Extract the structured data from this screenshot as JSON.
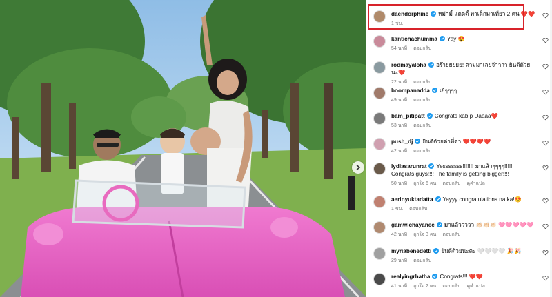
{
  "accent": "#d8232a",
  "verified_color": "#1d9bf0",
  "comments": [
    {
      "user": "daendorphine",
      "verified": true,
      "text": "หม่ามี้ แดดดี้ พาเด็กมาเที่ยว 2 คน ❤️❤️",
      "time": "1 ชม.",
      "likes": "",
      "reply": "",
      "translate": "",
      "avatar_color": "#b08a6a"
    },
    {
      "user": "kantichachumma",
      "verified": true,
      "text": "Yay 😍",
      "time": "54 นาที",
      "likes": "",
      "reply": "ตอบกลับ",
      "translate": "",
      "avatar_color": "#c98a9a"
    },
    {
      "user": "rodmayaloha",
      "verified": true,
      "text": "อร๊ายยยยย! ตามมาเลยจ้าาาา ยินดีด้วยนะ❤️",
      "time": "22 นาที",
      "likes": "",
      "reply": "ตอบกลับ",
      "translate": "",
      "avatar_color": "#8a9aa0"
    },
    {
      "user": "boompanadda",
      "verified": true,
      "text": "เย้ๆๆๆๆ",
      "time": "49 นาที",
      "likes": "",
      "reply": "ตอบกลับ",
      "translate": "",
      "avatar_color": "#a07a6a"
    },
    {
      "user": "bam_pitipatt",
      "verified": true,
      "text": "Congrats kab p Daaaa❤️",
      "time": "53 นาที",
      "likes": "",
      "reply": "ตอบกลับ",
      "translate": "",
      "avatar_color": "#7a7a7a"
    },
    {
      "user": "push_dj",
      "verified": true,
      "text": "ยินดีด้วยค่าพี่ดา ❤️❤️❤️❤️",
      "time": "42 นาที",
      "likes": "",
      "reply": "ตอบกลับ",
      "translate": "",
      "avatar_color": "#d0a0b0"
    },
    {
      "user": "lydiasarunrat",
      "verified": true,
      "text": "Yesssssss!!!!!!! มาแล้วๆๆๆๆ!!!!! Congrats guys!!!! The family is getting bigger!!!!",
      "time": "50 นาที",
      "likes": "ถูกใจ 6 คน",
      "reply": "ตอบกลับ",
      "translate": "ดูคำแปล",
      "avatar_color": "#6a5a4a"
    },
    {
      "user": "aerinyuktadatta",
      "verified": true,
      "text": "Yayyy congratulations na ka!😍",
      "time": "1 ชม.",
      "likes": "",
      "reply": "ตอบกลับ",
      "translate": "",
      "avatar_color": "#c08070"
    },
    {
      "user": "gamwichayanee",
      "verified": true,
      "text": "มาแล้ววววว 👏🏻👏🏻👏🏻 🩷🩷🩷🩷🩷",
      "time": "42 นาที",
      "likes": "ถูกใจ 3 คน",
      "reply": "ตอบกลับ",
      "translate": "",
      "avatar_color": "#b08a70"
    },
    {
      "user": "myriabenedetti",
      "verified": true,
      "text": "ยินดีด้วยนะคะ 🤍🤍🤍🤍 🎉🎉",
      "time": "29 นาที",
      "likes": "",
      "reply": "ตอบกลับ",
      "translate": "",
      "avatar_color": "#a0a0a0"
    },
    {
      "user": "realyingrhatha",
      "verified": true,
      "text": "Congrats!!! ❤️❤️",
      "time": "41 นาที",
      "likes": "ถูกใจ 2 คน",
      "reply": "ตอบกลับ",
      "translate": "ดูคำแปล",
      "avatar_color": "#4a4a4a"
    }
  ]
}
